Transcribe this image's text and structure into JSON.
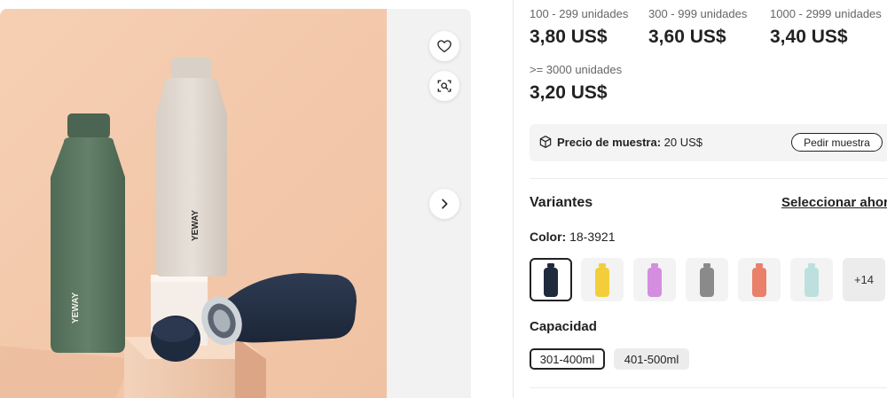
{
  "gallery": {
    "brand_text": "YEWAY",
    "favorite_icon": "heart-outline-icon",
    "image_search_icon": "image-search-icon",
    "next_icon": "chevron-right-icon"
  },
  "pricing": {
    "tiers": [
      {
        "range": "100 - 299 unidades",
        "price": "3,80 US$"
      },
      {
        "range": "300 - 999 unidades",
        "price": "3,60 US$"
      },
      {
        "range": "1000 - 2999 unidades",
        "price": "3,40 US$"
      },
      {
        "range": ">= 3000 unidades",
        "price": "3,20 US$"
      }
    ]
  },
  "sample": {
    "icon": "box-icon",
    "label": "Precio de muestra:",
    "value": " 20 US$",
    "button": "Pedir muestra"
  },
  "variants": {
    "title": "Variantes",
    "select_link": "Seleccionar ahora",
    "color_label": "Color:",
    "color_value": " 18-3921",
    "swatches": [
      {
        "color": "#1f2a3d",
        "selected": true
      },
      {
        "color": "#f2cf3a",
        "selected": false
      },
      {
        "color": "#d48ee0",
        "selected": false
      },
      {
        "color": "#8a8a8a",
        "selected": false
      },
      {
        "color": "#e9806a",
        "selected": false
      },
      {
        "color": "#bde0de",
        "selected": false
      }
    ],
    "more_label": "+14",
    "capacity_title": "Capacidad",
    "capacity_options": [
      {
        "label": "301-400ml",
        "selected": true
      },
      {
        "label": "401-500ml",
        "selected": false
      }
    ]
  }
}
